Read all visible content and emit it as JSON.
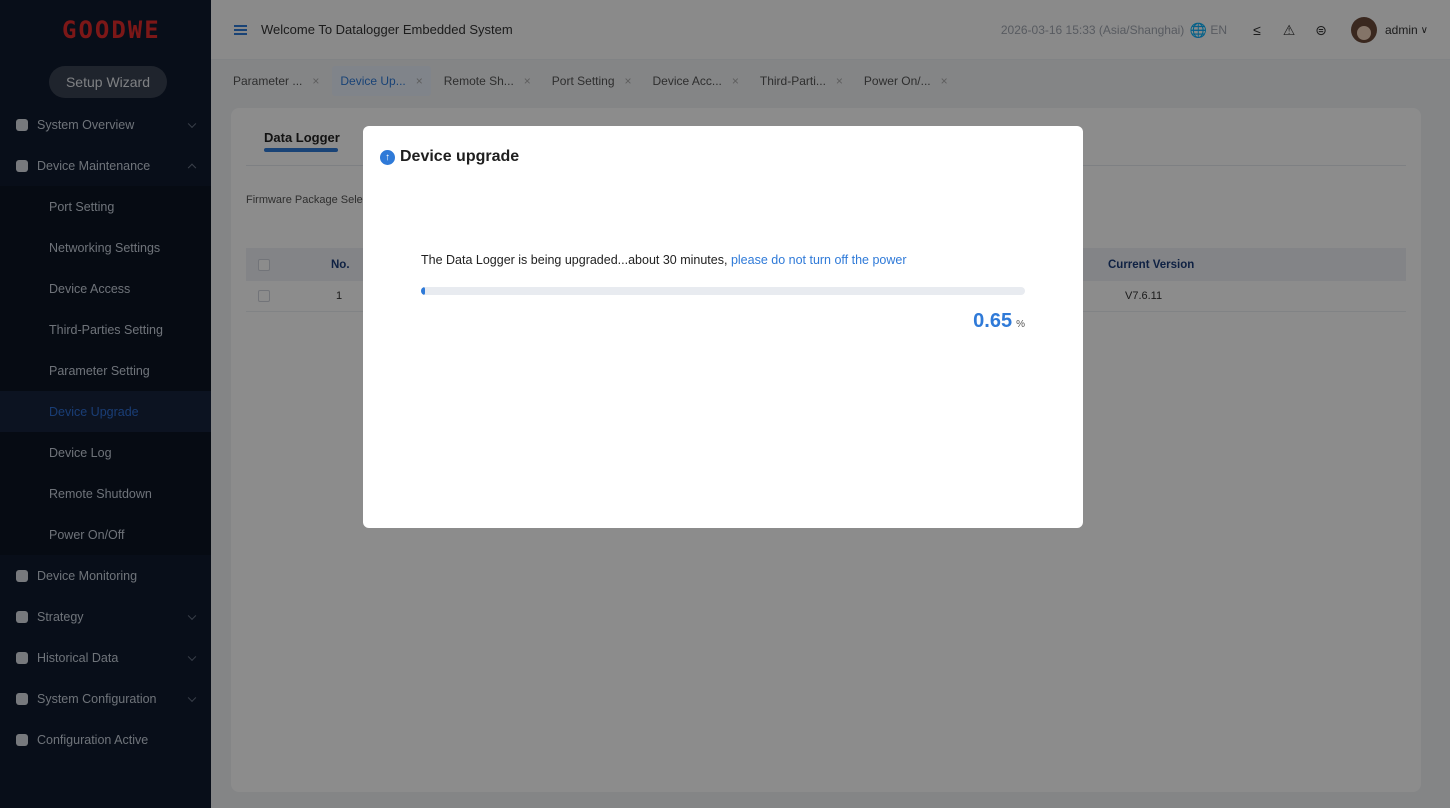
{
  "sidebar": {
    "logo": "GOODWE",
    "setup_wizard": "Setup Wizard",
    "items": [
      {
        "label": "System Overview",
        "type": "top",
        "chevron": "down"
      },
      {
        "label": "Device Maintenance",
        "type": "top",
        "chevron": "up"
      },
      {
        "label": "Port Setting",
        "type": "sub"
      },
      {
        "label": "Networking Settings",
        "type": "sub"
      },
      {
        "label": "Device Access",
        "type": "sub"
      },
      {
        "label": "Third-Parties Setting",
        "type": "sub"
      },
      {
        "label": "Parameter Setting",
        "type": "sub"
      },
      {
        "label": "Device Upgrade",
        "type": "sub",
        "active": true
      },
      {
        "label": "Device Log",
        "type": "sub"
      },
      {
        "label": "Remote Shutdown",
        "type": "sub"
      },
      {
        "label": "Power On/Off",
        "type": "sub"
      },
      {
        "label": "Device Monitoring",
        "type": "top"
      },
      {
        "label": "Strategy",
        "type": "top",
        "chevron": "down"
      },
      {
        "label": "Historical Data",
        "type": "top",
        "chevron": "down"
      },
      {
        "label": "System Configuration",
        "type": "top",
        "chevron": "down"
      },
      {
        "label": "Configuration Active",
        "type": "top"
      }
    ]
  },
  "header": {
    "title": "Welcome To Datalogger Embedded System",
    "datetime": "2026-03-16 15:33 (Asia/Shanghai)",
    "language": "EN",
    "user": "admin"
  },
  "tabs": [
    {
      "label": "Parameter ...",
      "active": false
    },
    {
      "label": "Device Up...",
      "active": true
    },
    {
      "label": "Remote Sh...",
      "active": false
    },
    {
      "label": "Port Setting",
      "active": false
    },
    {
      "label": "Device Acc...",
      "active": false
    },
    {
      "label": "Third-Parti...",
      "active": false
    },
    {
      "label": "Power On/...",
      "active": false
    }
  ],
  "content": {
    "section_tab": "Data Logger",
    "firmware_label": "Firmware Package Sele",
    "columns": {
      "no": "No.",
      "current_version": "Current Version"
    },
    "rows": [
      {
        "no": "1",
        "current_version": "V7.6.11"
      }
    ]
  },
  "modal": {
    "title": "Device upgrade",
    "message": "The Data Logger is being upgraded...about 30 minutes, ",
    "warning": "please do not turn off the power",
    "progress": 0.65,
    "progress_label": "0.65",
    "unit": "%"
  },
  "colors": {
    "accent": "#2f7ad8",
    "logo": "#e22a2a",
    "sidebar_bg": "#0f1a2e"
  }
}
